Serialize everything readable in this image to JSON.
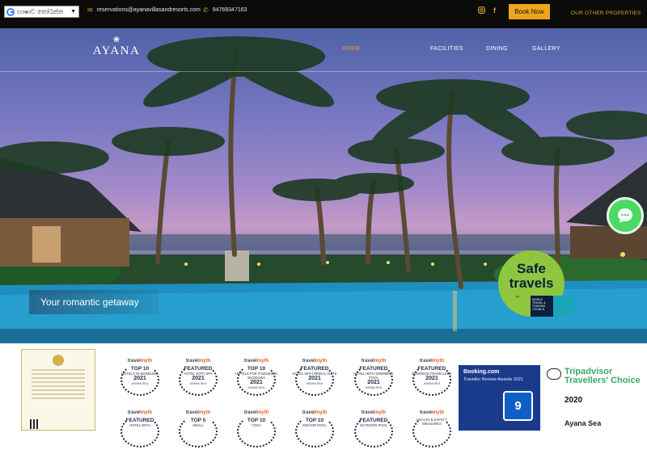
{
  "topbar": {
    "language_label": "භාෂාව තෝරන්න",
    "email": "reservations@ayanavillasandresorts.com",
    "phone": "94769347163",
    "book_now": "Book Now",
    "other_properties": "OUR OTHER PROPERTIES",
    "social_icons": [
      "instagram-icon",
      "facebook-icon"
    ],
    "accent_color": "#f0a41c"
  },
  "header": {
    "logo_text": "AYANA",
    "nav": [
      {
        "label": "HOME",
        "active": true
      },
      {
        "label": "FACILITIES",
        "active": false
      },
      {
        "label": "DINING",
        "active": false
      },
      {
        "label": "GALLERY",
        "active": false
      }
    ]
  },
  "hero": {
    "tagline": "Your romantic getaway",
    "safe_travels": {
      "line1": "Safe",
      "line2": "travels",
      "by": "by",
      "org": "WORLD TRAVEL & TOURISM COUNCIL"
    },
    "chat_icon": "chat-bubble-icon"
  },
  "awards": {
    "travelmyth": [
      {
        "big": "TOP 10",
        "small": "HOTELS IN WADDUWA",
        "year": "2021",
        "owner": "AYANA SEA"
      },
      {
        "big": "FEATURED",
        "small": "HOTEL WITH SPA",
        "year": "2021",
        "owner": "AYANA SEA"
      },
      {
        "big": "TOP 10",
        "small": "HOTELS FOR FAMILIES IN WADDUWA",
        "year": "2021",
        "owner": "AYANA SEA"
      },
      {
        "big": "FEATURED",
        "small": "HOTEL WITH BRIDAL SUITE",
        "year": "2021",
        "owner": "AYANA SEA"
      },
      {
        "big": "FEATURED",
        "small": "HOTEL WITH SWIMMING POOL",
        "year": "2021",
        "owner": "AYANA SEA"
      },
      {
        "big": "FEATURED",
        "small": "BUSINESS TRAVELLERS",
        "year": "2021",
        "owner": "AYANA SEA"
      },
      {
        "big": "FEATURED",
        "small": "HOTEL WITH",
        "year": "",
        "owner": ""
      },
      {
        "big": "TOP 5",
        "small": "SMALL",
        "year": "",
        "owner": ""
      },
      {
        "big": "TOP 10",
        "small": "YOGA",
        "year": "",
        "owner": ""
      },
      {
        "big": "TOP 10",
        "small": "INDOOR POOL",
        "year": "",
        "owner": ""
      },
      {
        "big": "FEATURED",
        "small": "OUTDOOR POOL",
        "year": "",
        "owner": ""
      },
      {
        "big": "",
        "small": "HEALTH & SAFETY MEASURES",
        "year": "",
        "owner": ""
      }
    ],
    "travelmyth_brand_1": "travel",
    "travelmyth_brand_2": "myth",
    "booking": {
      "title": "Booking.com",
      "subtitle": "Traveller Review Awards 2021",
      "score": "9"
    },
    "tripadvisor": {
      "title": "Tripadvisor Travellers' Choice",
      "year": "2020",
      "hotel": "Ayana Sea"
    }
  }
}
